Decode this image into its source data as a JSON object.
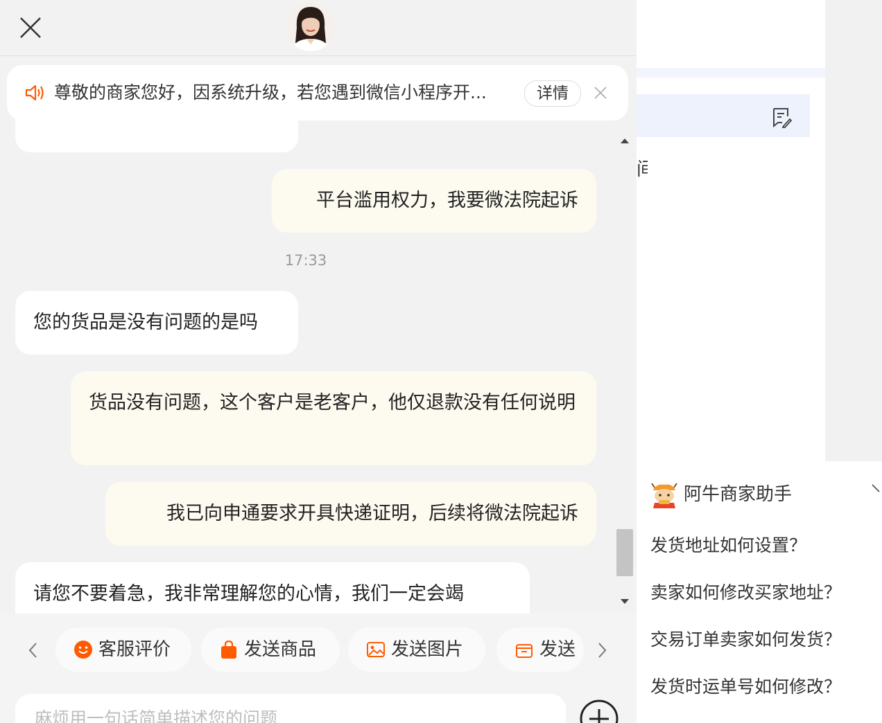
{
  "notice": {
    "text": "尊敬的商家您好，因系统升级，若您遇到微信小程序开...",
    "detail_label": "详情"
  },
  "messages": [
    {
      "side": "left",
      "text": ""
    },
    {
      "side": "right",
      "text": "平台滥用权力，我要微法院起诉"
    },
    {
      "side": "left",
      "text": "您的货品是没有问题的是吗"
    },
    {
      "side": "right",
      "text": "货品没有问题，这个客户是老客户，他仅退款没有任何说明"
    },
    {
      "side": "right",
      "text": "我已向申通要求开具快递证明，后续将微法院起诉"
    },
    {
      "side": "left",
      "text": "请您不要着急，我非常理解您的心情，我们一定会竭"
    }
  ],
  "timestamp": "17:33",
  "toolbar": {
    "chips": [
      {
        "label": "客服评价",
        "icon": "smiley-icon"
      },
      {
        "label": "发送商品",
        "icon": "shopping-bag-icon"
      },
      {
        "label": "发送图片",
        "icon": "image-icon"
      },
      {
        "label": "发送",
        "icon": "package-icon"
      }
    ]
  },
  "input": {
    "placeholder": "麻烦用一句话简单描述您的问题"
  },
  "right_panel": {
    "partial_text": "间",
    "assistant_title": "阿牛商家助手",
    "questions": [
      "发货地址如何设置？",
      "卖家如何修改买家地址？",
      "交易订单卖家如何发货？",
      "发货时运单号如何修改？"
    ]
  },
  "colors": {
    "panel_bg": "#f2f2f2",
    "user_bubble": "#fdfaf0",
    "agent_bubble": "#ffffff",
    "accent_orange": "#ff5a00",
    "selection_blue": "#edf2fc"
  }
}
